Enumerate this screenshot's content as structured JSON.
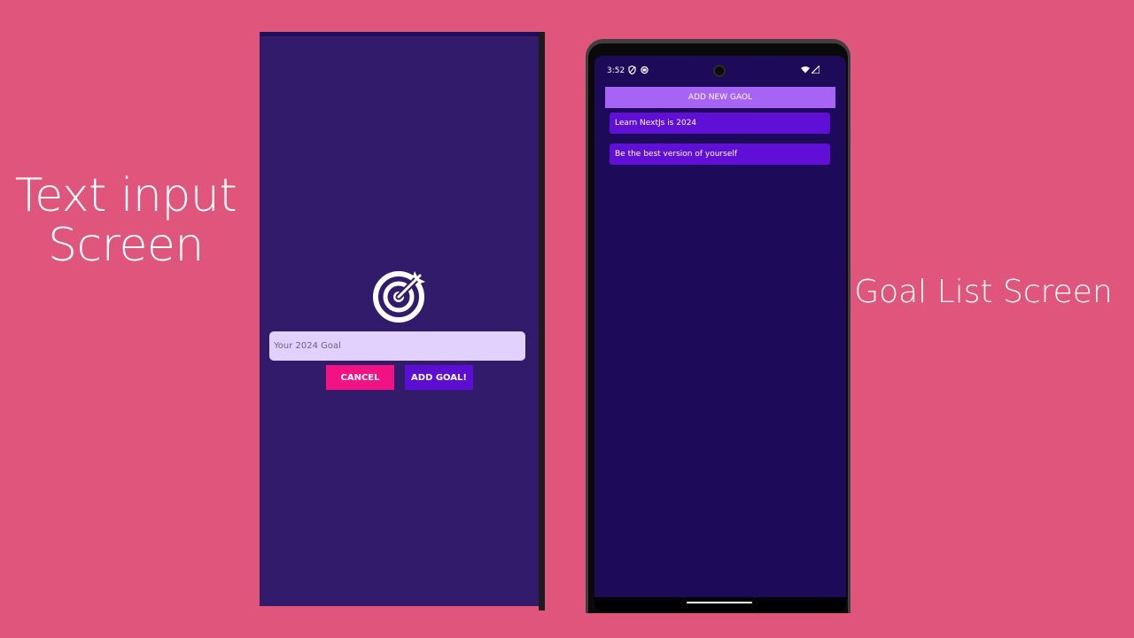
{
  "captions": {
    "left": "Text input Screen",
    "right": "Goal List Screen"
  },
  "input_screen": {
    "icon": "target-arrow-icon",
    "placeholder": "Your 2024 Goal",
    "cancel_label": "CANCEL",
    "add_label": "ADD GOAL!"
  },
  "goal_list_screen": {
    "status": {
      "time": "3:52",
      "left_icons": [
        "shield-icon",
        "sync-icon"
      ],
      "right_icons": [
        "wifi-icon",
        "signal-icon"
      ]
    },
    "add_button_label": "ADD NEW GAOL",
    "goals": [
      "Learn NextJs is 2024",
      "Be the best version of yourself"
    ]
  },
  "colors": {
    "background": "#e0557c",
    "input_screen_bg": "#311b6a",
    "list_screen_bg": "#1d0a58",
    "cancel_button": "#f31283",
    "add_button": "#5c0fd3",
    "add_new_goal_button": "#a663f4",
    "goal_item": "#600fd6",
    "input_bg": "#e3d1fd"
  }
}
